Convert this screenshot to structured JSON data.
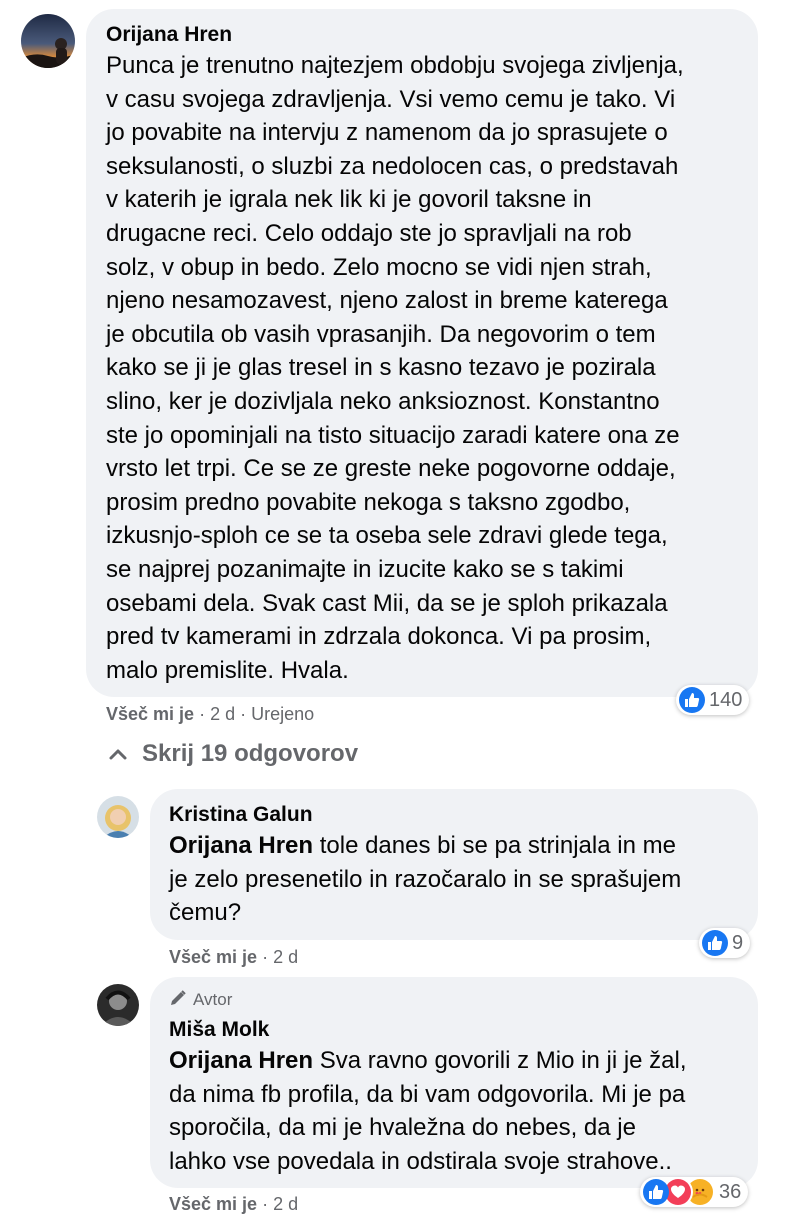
{
  "comment": {
    "author": "Orijana Hren",
    "lines": [
      "Punca je trenutno najtezjem obdobju svojega zivljenja,",
      "v casu svojega zdravljenja. Vsi vemo cemu je tako. Vi",
      "jo povabite na intervju z namenom da jo sprasujete o",
      "seksulanosti, o sluzbi za nedolocen cas, o predstavah",
      "v katerih je igrala nek lik ki je govoril taksne in",
      "drugacne reci. Celo oddajo ste jo spravljali na rob",
      "solz, v obup in bedo. Zelo mocno se vidi njen strah,",
      "njeno nesamozavest, njeno zalost in breme katerega",
      "je obcutila ob vasih vprasanjih. Da negovorim o tem",
      "kako se ji je glas tresel in s kasno tezavo je pozirala",
      "slino, ker je dozivljala neko anksioznost. Konstantno",
      "ste jo opominjali na tisto situacijo zaradi katere ona ze",
      "vrsto let trpi. Ce se ze greste neke pogovorne oddaje,",
      "prosim predno povabite nekoga s taksno zgodbo,",
      "izkusnjo-sploh ce se ta oseba sele zdravi glede tega,",
      "se najprej pozanimajte in izucite kako se s takimi",
      "osebami dela. Svak cast Mii, da se je sploh prikazala",
      "pred tv kamerami in zdrzala dokonca. Vi pa prosim,",
      "malo premislite. Hvala."
    ],
    "like_label": "Všeč mi je",
    "time": "2 d",
    "edited": "Urejeno",
    "reaction_count": "140",
    "reaction_icons": [
      "like-icon"
    ],
    "like_color": "#1877f2"
  },
  "replies_toggle": {
    "label": "Skrij 19 odgovorov",
    "icon": "chevron-up-icon"
  },
  "replies": [
    {
      "author": "Kristina Galun",
      "mention": "Orijana Hren",
      "lines": [
        " tole danes bi se pa strinjala in me",
        "je zelo presenetilo in razočaralo in se sprašujem",
        "čemu?"
      ],
      "like_label": "Všeč mi je",
      "time": "2 d",
      "reaction_count": "9",
      "reaction_icons": [
        "like-icon"
      ]
    },
    {
      "badge": "Avtor",
      "badge_icon": "pencil-icon",
      "author": "Miša Molk",
      "mention": "Orijana Hren",
      "lines": [
        " Sva ravno govorili z Mio in ji je žal,",
        "da nima fb profila, da bi vam odgovorila. Mi je pa",
        "sporočila, da mi je hvaležna do nebes, da je",
        "lahko vse povedala in odstirala svoje strahove.."
      ],
      "like_label": "Všeč mi je",
      "time": "2 d",
      "reaction_count": "36",
      "reaction_icons": [
        "like-icon",
        "love-icon",
        "care-icon"
      ],
      "love_color": "#f33e58",
      "care_color": "#f7b125"
    }
  ]
}
